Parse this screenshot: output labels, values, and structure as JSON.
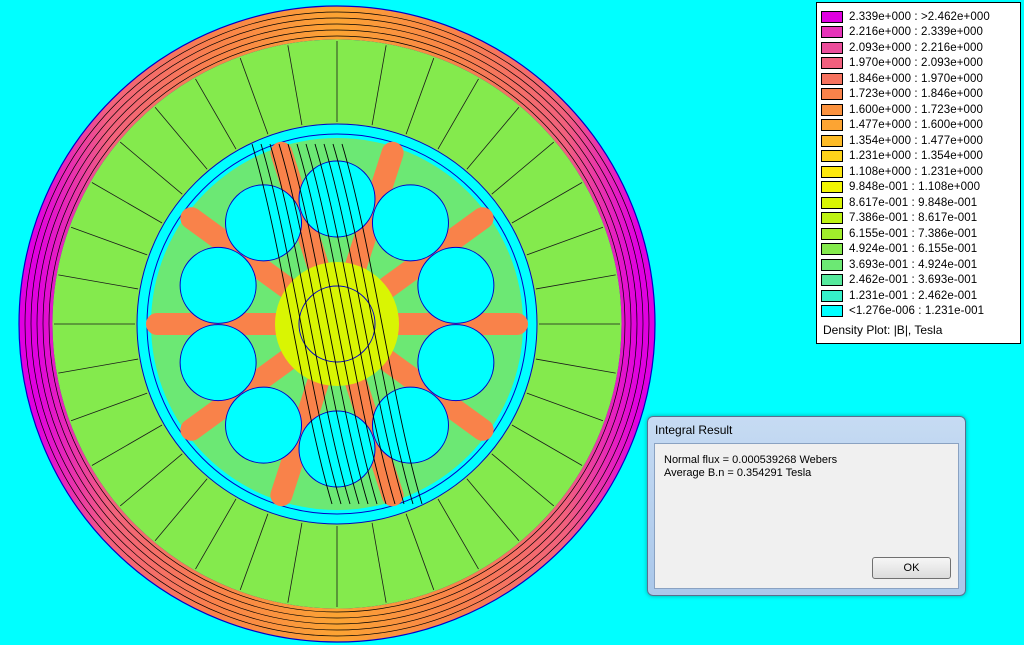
{
  "legend": {
    "rows": [
      {
        "label": "2.339e+000 : >2.462e+000",
        "color": "#e000e0"
      },
      {
        "label": "2.216e+000 : 2.339e+000",
        "color": "#e633b9"
      },
      {
        "label": "2.093e+000 : 2.216e+000",
        "color": "#ec4d9a"
      },
      {
        "label": "1.970e+000 : 2.093e+000",
        "color": "#f2607e"
      },
      {
        "label": "1.846e+000 : 1.970e+000",
        "color": "#f6725e"
      },
      {
        "label": "1.723e+000 : 1.846e+000",
        "color": "#f9824a"
      },
      {
        "label": "1.600e+000 : 1.723e+000",
        "color": "#fb923e"
      },
      {
        "label": "1.477e+000 : 1.600e+000",
        "color": "#fca433"
      },
      {
        "label": "1.354e+000 : 1.477e+000",
        "color": "#fdbb26"
      },
      {
        "label": "1.231e+000 : 1.354e+000",
        "color": "#fed31a"
      },
      {
        "label": "1.108e+000 : 1.231e+000",
        "color": "#fde80e"
      },
      {
        "label": "9.848e-001 : 1.108e+000",
        "color": "#f2f502"
      },
      {
        "label": "8.617e-001 : 9.848e-001",
        "color": "#d9f503"
      },
      {
        "label": "7.386e-001 : 8.617e-001",
        "color": "#bdf212"
      },
      {
        "label": "6.155e-001 : 7.386e-001",
        "color": "#a0ee2b"
      },
      {
        "label": "4.924e-001 : 6.155e-001",
        "color": "#84ea4d"
      },
      {
        "label": "3.693e-001 : 4.924e-001",
        "color": "#6ce874"
      },
      {
        "label": "2.462e-001 : 3.693e-001",
        "color": "#55e99c"
      },
      {
        "label": "1.231e-001 : 2.462e-001",
        "color": "#35f0c8"
      },
      {
        "label": "<1.276e-006 : 1.231e-001",
        "color": "#00ffff"
      }
    ],
    "caption": "Density Plot: |B|, Tesla"
  },
  "dialog": {
    "title": "Integral Result",
    "line1": "Normal flux = 0.000539268 Webers",
    "line2": "Average B.n = 0.354291 Tesla",
    "ok_label": "OK"
  },
  "colors": {
    "background": "#00ffff",
    "stator_teeth": "#84ea4d",
    "outer_ring_hot": "#e000e0",
    "outer_ring_warm": "#f9824a",
    "rotor_core": "#d9f503",
    "rotor_spokes": "#f9824a",
    "boundary_lines": "#0000c8",
    "flux_lines": "#000000"
  }
}
